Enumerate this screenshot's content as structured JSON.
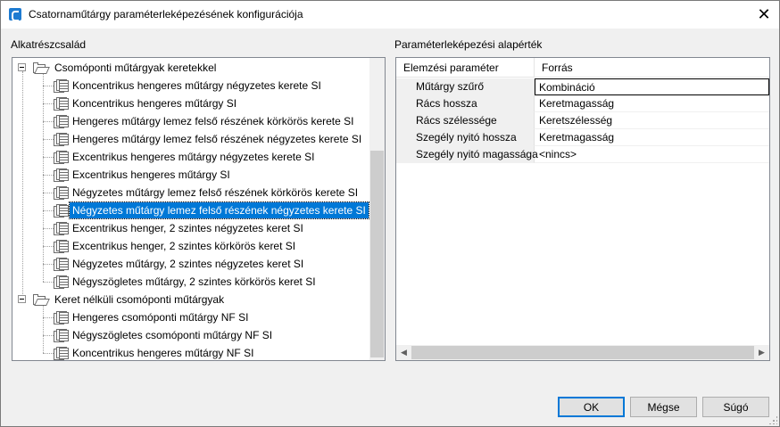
{
  "window": {
    "title": "Csatornaműtárgy paraméterleképezésének konfigurációja",
    "close_glyph": "✕"
  },
  "left_section": {
    "label": "Alkatrészcsalád",
    "tree": {
      "groups": [
        {
          "label": "Csomóponti műtárgyak keretekkel",
          "expanded": true,
          "items": [
            "Koncentrikus hengeres műtárgy négyzetes kerete SI",
            "Koncentrikus hengeres műtárgy SI",
            "Hengeres műtárgy lemez felső részének körkörös kerete SI",
            "Hengeres műtárgy lemez felső részének négyzetes kerete SI",
            "Excentrikus hengeres műtárgy négyzetes kerete SI",
            "Excentrikus hengeres műtárgy SI",
            "Négyzetes műtárgy lemez felső részének körkörös kerete SI",
            "Négyzetes műtárgy lemez felső részének négyzetes kerete SI",
            "Excentrikus henger, 2 szintes négyzetes keret SI",
            "Excentrikus henger, 2 szintes körkörös keret SI",
            "Négyzetes műtárgy, 2 szintes négyzetes keret SI",
            "Négyszögletes műtárgy, 2 szintes körkörös keret SI"
          ]
        },
        {
          "label": "Keret nélküli csomóponti műtárgyak",
          "expanded": true,
          "items": [
            "Hengeres csomóponti műtárgy NF SI",
            "Négyszögletes csomóponti műtárgy NF SI",
            "Koncentrikus hengeres műtárgy NF SI"
          ]
        }
      ],
      "selected_item": "Négyzetes műtárgy lemez felső részének négyzetes kerete SI"
    }
  },
  "right_section": {
    "label": "Paraméterleképezési alapérték",
    "grid": {
      "headers": [
        "Elemzési paraméter",
        "Forrás"
      ],
      "rows": [
        {
          "parameter": "Műtárgy szűrő",
          "source": "Kombináció"
        },
        {
          "parameter": "Rács hossza",
          "source": "Keretmagasság"
        },
        {
          "parameter": "Rács szélessége",
          "source": "Keretszélesség"
        },
        {
          "parameter": "Szegély nyitó hossza",
          "source": "Keretmagasság"
        },
        {
          "parameter": "Szegély nyitó magassága",
          "source": "<nincs>"
        }
      ],
      "active_row": 0
    }
  },
  "buttons": {
    "ok": "OK",
    "cancel": "Mégse",
    "help": "Súgó"
  },
  "colors": {
    "selection": "#0078d7",
    "window_bg": "#f0f0f0",
    "brand_icon": "#1e7bd1"
  },
  "icons": {
    "app": "civil3d-app-icon",
    "group": "open-folder-icon",
    "item": "structure-family-icon"
  }
}
